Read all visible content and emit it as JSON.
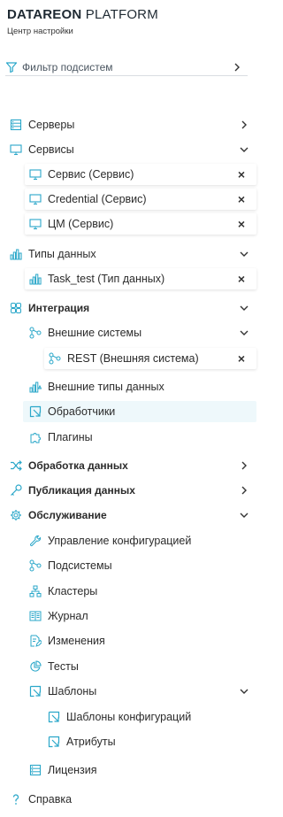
{
  "brand": {
    "bold": "DATAREON",
    "light": "PLATFORM",
    "subtitle": "Центр настройки"
  },
  "filter": {
    "label": "Фильтр подсистем"
  },
  "nav": {
    "servers": "Серверы",
    "services": "Сервисы",
    "service_items": [
      "Сервис (Сервис)",
      "Credential (Сервис)",
      "ЦМ (Сервис)"
    ],
    "data_types": "Типы данных",
    "data_type_items": [
      "Task_test (Тип данных)"
    ],
    "integration": "Интеграция",
    "external_systems": "Внешние системы",
    "external_system_items": [
      "REST (Внешняя система)"
    ],
    "external_data_types": "Внешние типы данных",
    "handlers": "Обработчики",
    "plugins": "Плагины",
    "data_processing": "Обработка данных",
    "data_publishing": "Публикация данных",
    "maintenance": "Обслуживание",
    "maintenance_items": {
      "config_management": "Управление конфигурацией",
      "subsystems": "Подсистемы",
      "clusters": "Кластеры",
      "journal": "Журнал",
      "changes": "Изменения",
      "tests": "Тесты",
      "templates": "Шаблоны",
      "config_templates": "Шаблоны конфигураций",
      "attributes": "Атрибуты",
      "license": "Лицензия"
    },
    "help": "Справка"
  },
  "colors": {
    "accent": "#2aa7c9",
    "selected_bg": "#eef8fb",
    "text": "#2b2b2b"
  }
}
